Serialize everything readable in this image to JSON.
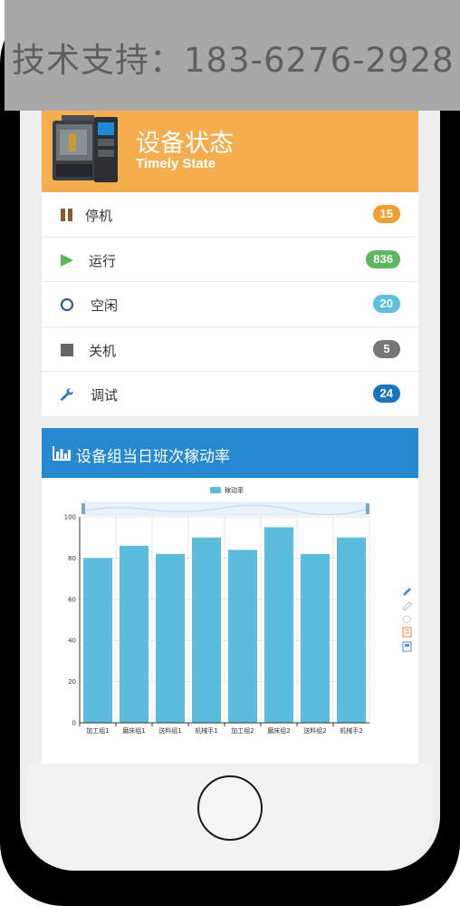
{
  "watermark": {
    "text": "技术支持：183-6276-2928"
  },
  "status_panel": {
    "title": "设备状态",
    "subtitle": "Timely State",
    "rows": [
      {
        "label": "停机",
        "count": "15",
        "icon": "pause-icon",
        "badge_color": "#f0a030"
      },
      {
        "label": "运行",
        "count": "836",
        "icon": "play-icon",
        "badge_color": "#5cb85c"
      },
      {
        "label": "空闲",
        "count": "20",
        "icon": "circle-icon",
        "badge_color": "#5bc0de"
      },
      {
        "label": "关机",
        "count": "5",
        "icon": "stop-icon",
        "badge_color": "#777777"
      },
      {
        "label": "调试",
        "count": "24",
        "icon": "wrench-icon",
        "badge_color": "#1b75bb"
      }
    ]
  },
  "chart_panel": {
    "title": "设备组当日班次稼动率"
  },
  "chart_data": {
    "type": "bar",
    "legend": "稼动率",
    "categories": [
      "加工组1",
      "磨床组1",
      "送料组1",
      "机械手1",
      "加工组2",
      "磨床组2",
      "送料组2",
      "机械手2"
    ],
    "series": [
      {
        "name": "稼动率",
        "values": [
          80,
          86,
          82,
          90,
          84,
          95,
          82,
          90
        ]
      }
    ],
    "ylim": [
      0,
      100
    ],
    "yticks": [
      "0",
      "20",
      "40",
      "60",
      "80",
      "100"
    ],
    "color": "#5bbcdd",
    "grid": true
  },
  "toolbox": [
    "pencil-icon",
    "eraser-icon",
    "refresh-icon",
    "data-view-icon",
    "save-icon"
  ]
}
